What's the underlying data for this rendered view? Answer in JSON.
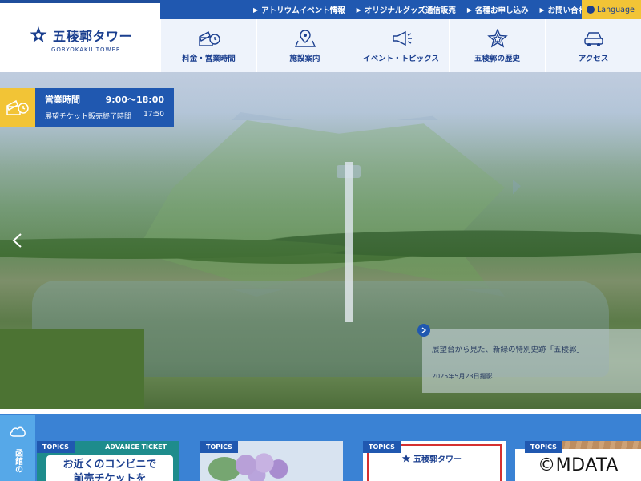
{
  "header": {
    "logo_text": "五稜郭タワー",
    "logo_sub": "GORYOKAKU TOWER",
    "top_links": [
      {
        "label": "アトリウムイベント情報"
      },
      {
        "label": "オリジナルグッズ通信販売"
      },
      {
        "label": "各種お申し込み"
      },
      {
        "label": "お問い合わせ"
      }
    ],
    "language_label": "Language"
  },
  "nav": [
    {
      "label": "料金・営業時間",
      "icon": "ticket-clock-icon"
    },
    {
      "label": "施設案内",
      "icon": "map-pin-icon"
    },
    {
      "label": "イベント・トピックス",
      "icon": "megaphone-icon"
    },
    {
      "label": "五稜郭の歴史",
      "icon": "star-fort-icon"
    },
    {
      "label": "アクセス",
      "icon": "car-icon"
    }
  ],
  "hours": {
    "label": "営業時間",
    "time": "9:00～18:00",
    "ticket_label": "展望チケット販売終了時間",
    "ticket_time": "17:50"
  },
  "slide": {
    "caption": "展望台から見た、新緑の特別史跡「五稜郭」",
    "date": "2025年5月23日撮影"
  },
  "topics": {
    "weather_label": "函館の",
    "cards": [
      {
        "tag": "TOPICS",
        "badge": "ADVANCE TICKET",
        "promo_line1": "お近くのコンビニで",
        "promo_line2": "前売チケットを"
      },
      {
        "tag": "TOPICS"
      },
      {
        "tag": "TOPICS",
        "logo_text": "五稜郭タワー"
      },
      {
        "tag": "TOPICS"
      }
    ]
  },
  "watermark": "©MDATA",
  "colors": {
    "primary": "#2058b0",
    "accent": "#f2c436",
    "nav_bg": "#eef3fb",
    "topics_bg": "#3a82d4"
  }
}
